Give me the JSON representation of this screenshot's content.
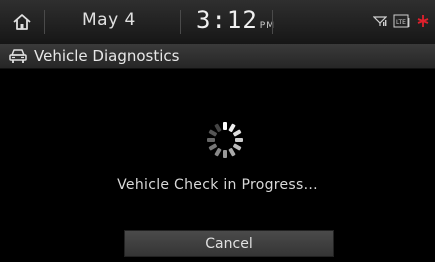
{
  "status_bar": {
    "date": "May 4",
    "time": "3:12",
    "ampm": "PM",
    "icons": [
      "home-icon",
      "signal-icon",
      "lte-icon",
      "bluetooth-icon"
    ],
    "accent_color": "#e0202c"
  },
  "title_bar": {
    "title": "Vehicle Diagnostics",
    "icon": "car-icon"
  },
  "main": {
    "progress_text": "Vehicle Check in Progress...",
    "cancel_label": "Cancel"
  }
}
